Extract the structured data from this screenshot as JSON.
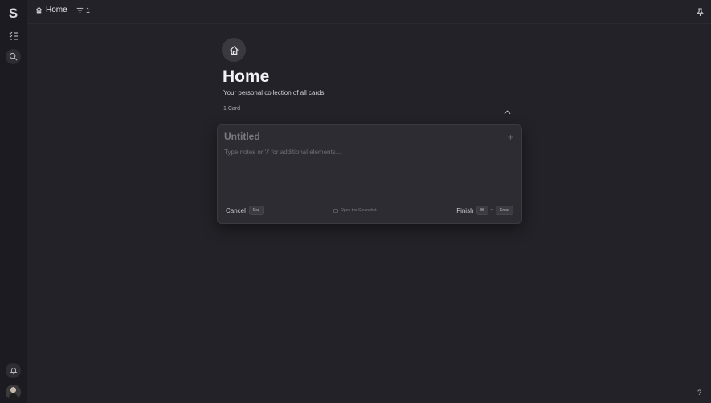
{
  "sidebar": {
    "logo": "S",
    "icons": [
      "checklist-icon",
      "search-icon",
      "bell-icon"
    ]
  },
  "topbar": {
    "breadcrumb": "Home",
    "filter_count": "1"
  },
  "page": {
    "title": "Home",
    "subtitle": "Your personal collection of all cards",
    "count_label": "1 Card"
  },
  "card": {
    "title_placeholder": "Untitled",
    "notes_placeholder": "Type notes or '/' for additional elements...",
    "cancel_label": "Cancel",
    "cancel_key": "Esc",
    "cleanup_label": "Open the Cleanshot",
    "finish_label": "Finish",
    "finish_key1": "⌘",
    "finish_plus": "+",
    "finish_key2": "Enter"
  },
  "footer": {
    "help": "?"
  }
}
